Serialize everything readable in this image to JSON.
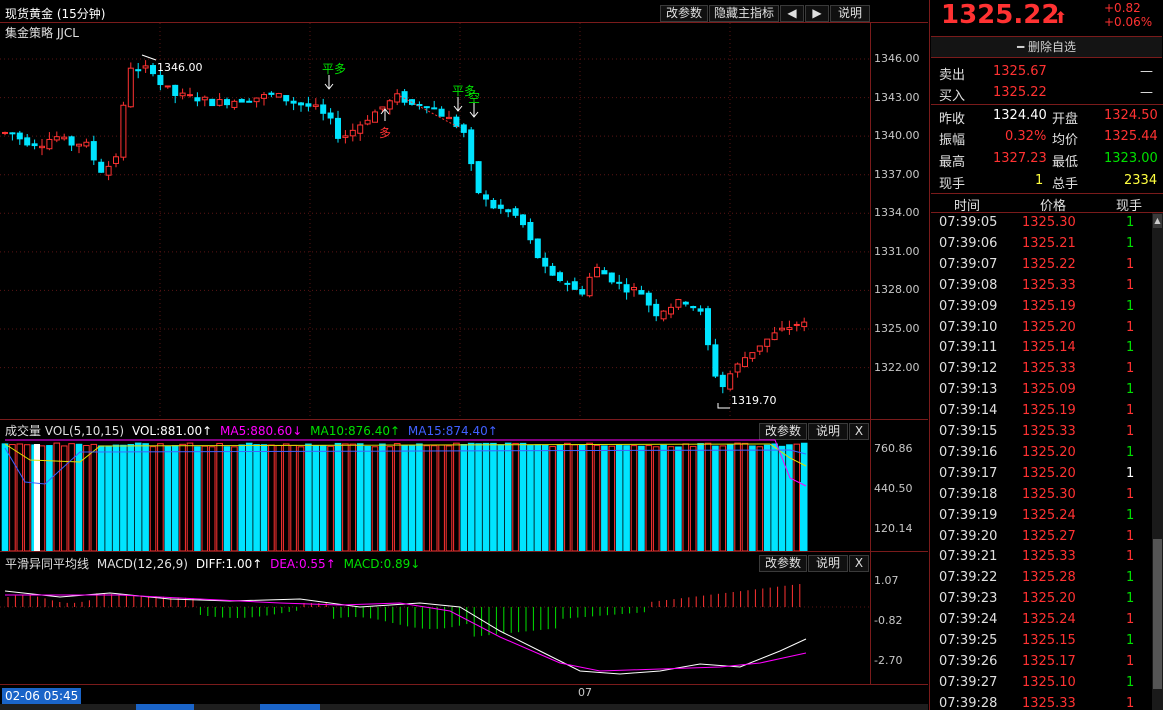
{
  "header": {
    "title": "现货黄金 (15分钟)",
    "buttons": [
      "改参数",
      "隐藏主指标",
      "◀",
      "▶",
      "说明"
    ]
  },
  "main": {
    "strategy_label": "集金策略 JJCL",
    "y_ticks": [
      "1346.00",
      "1343.00",
      "1340.00",
      "1337.00",
      "1334.00",
      "1331.00",
      "1328.00",
      "1325.00",
      "1322.00"
    ],
    "y_tick_values": [
      1346,
      1343,
      1340,
      1337,
      1334,
      1331,
      1328,
      1325,
      1322
    ],
    "high_label": "1346.00",
    "low_label": "1319.70",
    "signals": [
      {
        "text": "平多",
        "color": "#00e000"
      },
      {
        "text": "多",
        "color": "#ff3232"
      },
      {
        "text": "平多",
        "color": "#00e000"
      },
      {
        "text": "空",
        "color": "#00e000"
      }
    ]
  },
  "volume_panel": {
    "title": "成交量 VOL(5,10,15)",
    "vol": "VOL:881.00↑",
    "ma5": "MA5:880.60↓",
    "ma10": "MA10:876.40↑",
    "ma15": "MA15:874.40↑",
    "buttons": [
      "改参数",
      "说明",
      "X"
    ],
    "y_ticks": [
      "760.86",
      "440.50",
      "120.14"
    ]
  },
  "macd_panel": {
    "title": "平滑异同平均线",
    "params": "MACD(12,26,9)",
    "diff": "DIFF:1.00↑",
    "dea": "DEA:0.55↑",
    "macd": "MACD:0.89↓",
    "buttons": [
      "改参数",
      "说明",
      "X"
    ],
    "y_ticks": [
      "1.07",
      "-0.82",
      "-2.70"
    ]
  },
  "bottom": {
    "time_label": "02-06 05:45",
    "date_mark": "07"
  },
  "colors": {
    "up": "#ff3232",
    "down": "#00e4ff",
    "ma5": "#ffffff",
    "ma10": "#e0e000",
    "ma15": "#ff00ff",
    "ma_blue": "#4060ff"
  },
  "quote": {
    "price": "1325.22",
    "arrow": "⬆",
    "change": "+0.82",
    "change_pct": "+0.06%",
    "remove_fav": "删除自选",
    "sell_label": "卖出",
    "sell": "1325.67",
    "sell_qty": "—",
    "buy_label": "买入",
    "buy": "1325.22",
    "buy_qty": "—",
    "prev_close_label": "昨收",
    "prev_close": "1324.40",
    "open_label": "开盘",
    "open": "1324.50",
    "amp_label": "振幅",
    "amp": "0.32%",
    "avg_label": "均价",
    "avg": "1325.44",
    "high_label": "最高",
    "high": "1327.23",
    "low_label": "最低",
    "low": "1323.00",
    "cur_vol_label": "现手",
    "cur_vol": "1",
    "total_vol_label": "总手",
    "total_vol": "2334"
  },
  "ticks": {
    "headers": [
      "时间",
      "价格",
      "现手"
    ],
    "rows": [
      {
        "time": "07:39:05",
        "price": "1325.30",
        "vol": "1",
        "vc": "green"
      },
      {
        "time": "07:39:06",
        "price": "1325.21",
        "vol": "1",
        "vc": "green"
      },
      {
        "time": "07:39:07",
        "price": "1325.22",
        "vol": "1",
        "vc": "red"
      },
      {
        "time": "07:39:08",
        "price": "1325.33",
        "vol": "1",
        "vc": "red"
      },
      {
        "time": "07:39:09",
        "price": "1325.19",
        "vol": "1",
        "vc": "green"
      },
      {
        "time": "07:39:10",
        "price": "1325.20",
        "vol": "1",
        "vc": "red"
      },
      {
        "time": "07:39:11",
        "price": "1325.14",
        "vol": "1",
        "vc": "green"
      },
      {
        "time": "07:39:12",
        "price": "1325.33",
        "vol": "1",
        "vc": "red"
      },
      {
        "time": "07:39:13",
        "price": "1325.09",
        "vol": "1",
        "vc": "green"
      },
      {
        "time": "07:39:14",
        "price": "1325.19",
        "vol": "1",
        "vc": "red"
      },
      {
        "time": "07:39:15",
        "price": "1325.33",
        "vol": "1",
        "vc": "red"
      },
      {
        "time": "07:39:16",
        "price": "1325.20",
        "vol": "1",
        "vc": "green"
      },
      {
        "time": "07:39:17",
        "price": "1325.20",
        "vol": "1",
        "vc": "white"
      },
      {
        "time": "07:39:18",
        "price": "1325.30",
        "vol": "1",
        "vc": "red"
      },
      {
        "time": "07:39:19",
        "price": "1325.24",
        "vol": "1",
        "vc": "green"
      },
      {
        "time": "07:39:20",
        "price": "1325.27",
        "vol": "1",
        "vc": "red"
      },
      {
        "time": "07:39:21",
        "price": "1325.33",
        "vol": "1",
        "vc": "red"
      },
      {
        "time": "07:39:22",
        "price": "1325.28",
        "vol": "1",
        "vc": "green"
      },
      {
        "time": "07:39:23",
        "price": "1325.20",
        "vol": "1",
        "vc": "green"
      },
      {
        "time": "07:39:24",
        "price": "1325.24",
        "vol": "1",
        "vc": "red"
      },
      {
        "time": "07:39:25",
        "price": "1325.15",
        "vol": "1",
        "vc": "green"
      },
      {
        "time": "07:39:26",
        "price": "1325.17",
        "vol": "1",
        "vc": "red"
      },
      {
        "time": "07:39:27",
        "price": "1325.10",
        "vol": "1",
        "vc": "green"
      },
      {
        "time": "07:39:28",
        "price": "1325.33",
        "vol": "1",
        "vc": "red"
      }
    ]
  }
}
